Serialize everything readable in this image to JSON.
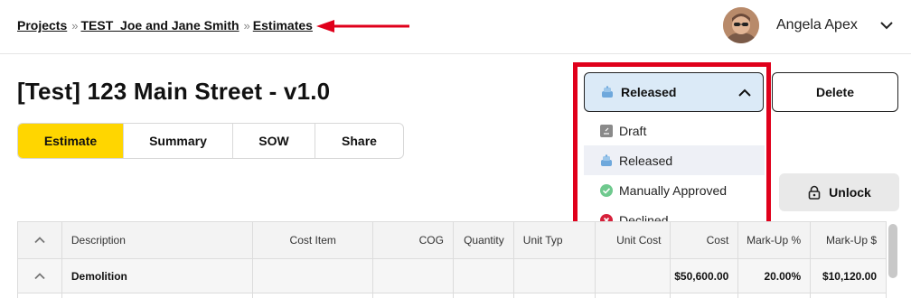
{
  "breadcrumb": {
    "items": [
      "Projects",
      "TEST_Joe and Jane Smith",
      "Estimates"
    ],
    "separator": "»"
  },
  "user": {
    "name": "Angela Apex"
  },
  "page_title": "[Test] 123 Main Street - v1.0",
  "tabs": [
    {
      "label": "Estimate",
      "active": true
    },
    {
      "label": "Summary",
      "active": false
    },
    {
      "label": "SOW",
      "active": false
    },
    {
      "label": "Share",
      "active": false
    }
  ],
  "status_dropdown": {
    "selected": "Released",
    "options": [
      {
        "label": "Draft",
        "icon": "draft-icon"
      },
      {
        "label": "Released",
        "icon": "released-icon"
      },
      {
        "label": "Manually Approved",
        "icon": "check-circle-icon"
      },
      {
        "label": "Declined",
        "icon": "x-circle-icon"
      }
    ]
  },
  "buttons": {
    "delete": "Delete",
    "unlock": "Unlock"
  },
  "table": {
    "columns": [
      "Description",
      "Cost Item",
      "COG",
      "Quantity",
      "Unit Typ",
      "Unit Cost",
      "Cost",
      "Mark-Up %",
      "Mark-Up $"
    ],
    "group_row": {
      "description": "Demolition",
      "cost": "$50,600.00",
      "markup_pct": "20.00%",
      "markup_amt": "$10,120.00"
    }
  },
  "colors": {
    "accent_yellow": "#ffd600",
    "annotation_red": "#e0001b",
    "released_blue": "#dbeaf7"
  }
}
